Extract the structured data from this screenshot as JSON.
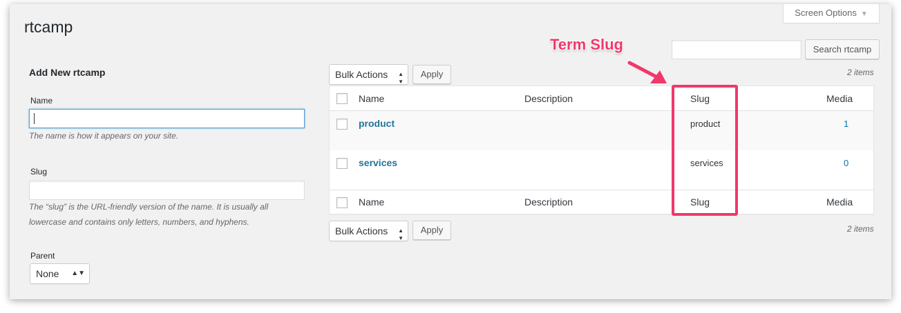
{
  "page": {
    "title": "rtcamp",
    "screen_options_label": "Screen Options"
  },
  "search": {
    "value": "",
    "button_label": "Search rtcamp"
  },
  "add_form": {
    "heading": "Add New rtcamp",
    "name_label": "Name",
    "name_value": "",
    "name_help": "The name is how it appears on your site.",
    "slug_label": "Slug",
    "slug_value": "",
    "slug_help_line1": "The “slug” is the URL-friendly version of the name. It is usually all",
    "slug_help_line2": "lowercase and contains only letters, numbers, and hyphens.",
    "parent_label": "Parent",
    "parent_value": "None"
  },
  "bulk": {
    "top_select": "Bulk Actions",
    "top_apply": "Apply",
    "bottom_select": "Bulk Actions",
    "bottom_apply": "Apply",
    "count_top": "2 items",
    "count_bottom": "2 items"
  },
  "table": {
    "columns": {
      "name": "Name",
      "description": "Description",
      "slug": "Slug",
      "media": "Media"
    },
    "rows": [
      {
        "name": "product",
        "description": "",
        "slug": "product",
        "media": "1"
      },
      {
        "name": "services",
        "description": "",
        "slug": "services",
        "media": "0"
      }
    ]
  },
  "annotation": {
    "label": "Term Slug",
    "color": "#f0386b"
  },
  "icons": {
    "screen_options": "triangle-down-icon",
    "select": "up-down-arrows-icon"
  }
}
